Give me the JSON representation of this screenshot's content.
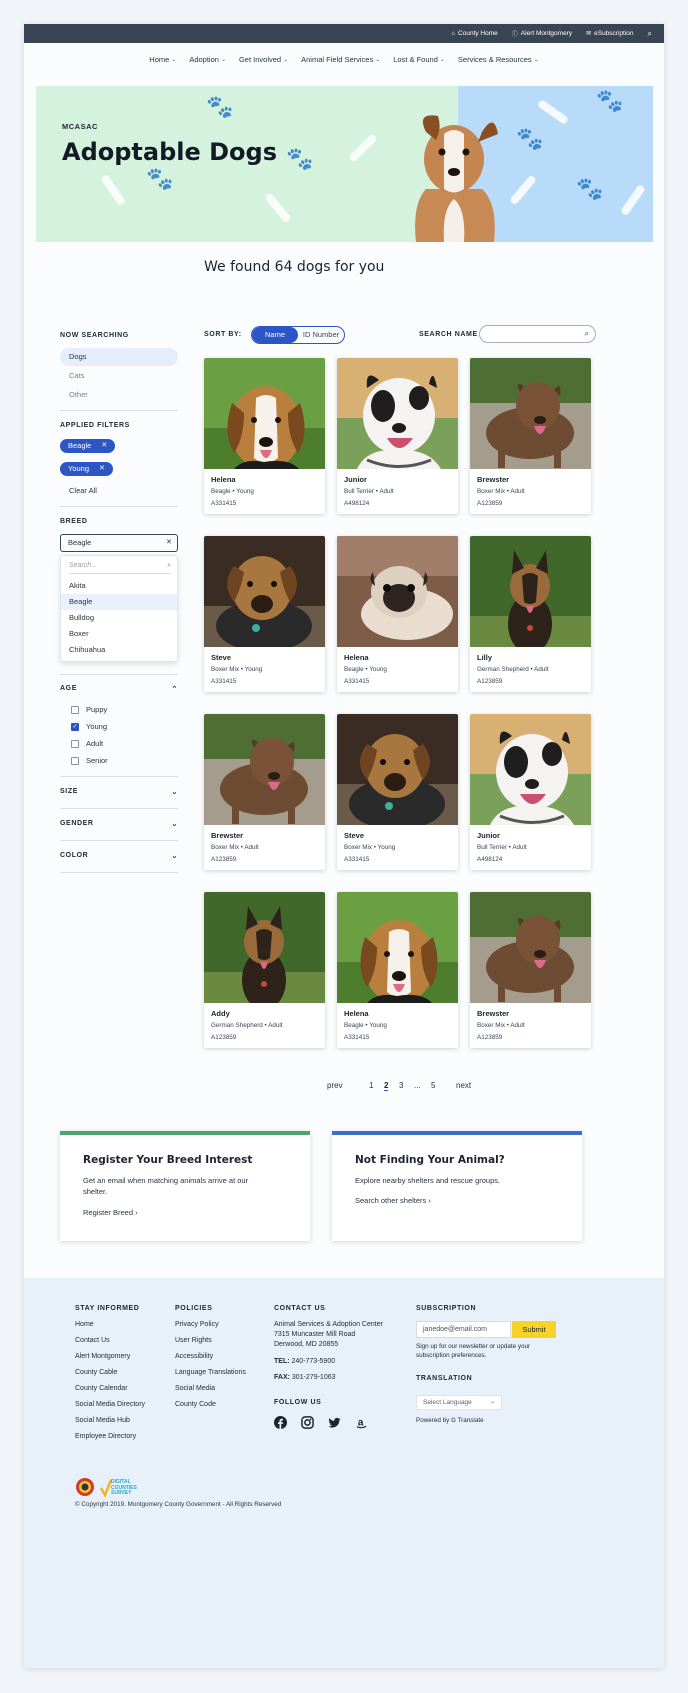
{
  "utility_bar": {
    "links": [
      "County Home",
      "Alert Montgomery",
      "eSubscription"
    ]
  },
  "main_nav": {
    "items": [
      "Home",
      "Adoption",
      "Get Involved",
      "Animal Field Services",
      "Lost & Found",
      "Services & Resources"
    ]
  },
  "hero": {
    "eyebrow": "MCASAC",
    "title": "Adoptable Dogs"
  },
  "results": {
    "title": "We found 64 dogs for you"
  },
  "sidebar": {
    "now_searching_label": "NOW SEARCHING",
    "species": [
      "Dogs",
      "Cats",
      "Other"
    ],
    "applied_filters_label": "APPLIED FILTERS",
    "chips": [
      "Beagle",
      "Young"
    ],
    "clear_all": "Clear All",
    "breed_label": "BREED",
    "breed_value": "Beagle",
    "breed_search_placeholder": "Search...",
    "breed_options": [
      "Akita",
      "Beagle",
      "Bulldog",
      "Boxer",
      "Chihuahua"
    ],
    "age_label": "AGE",
    "age_options": [
      {
        "label": "Puppy",
        "checked": false
      },
      {
        "label": "Young",
        "checked": true
      },
      {
        "label": "Adult",
        "checked": false
      },
      {
        "label": "Senior",
        "checked": false
      }
    ],
    "size_label": "SIZE",
    "gender_label": "GENDER",
    "color_label": "COLOR"
  },
  "sort": {
    "label": "SORT BY:",
    "options": [
      "Name",
      "ID Number"
    ],
    "selected": "Name",
    "search_label": "SEARCH NAME"
  },
  "cards": [
    {
      "name": "Helena",
      "meta": "Beagle • Young",
      "id": "A331415",
      "breed_kind": "beagle"
    },
    {
      "name": "Junior",
      "meta": "Bull Terrier • Adult",
      "id": "A498124",
      "breed_kind": "bullterrier"
    },
    {
      "name": "Brewster",
      "meta": "Boxer Mix • Adult",
      "id": "A123859",
      "breed_kind": "brewster"
    },
    {
      "name": "Steve",
      "meta": "Boxer Mix • Young",
      "id": "A331415",
      "breed_kind": "steve"
    },
    {
      "name": "Helena",
      "meta": "Beagle • Young",
      "id": "A331415",
      "breed_kind": "pug"
    },
    {
      "name": "Lilly",
      "meta": "German Shepherd • Adult",
      "id": "A123859",
      "breed_kind": "shepherd"
    },
    {
      "name": "Brewster",
      "meta": "Boxer Mix • Adult",
      "id": "A123859",
      "breed_kind": "brewster"
    },
    {
      "name": "Steve",
      "meta": "Boxer Mix • Young",
      "id": "A331415",
      "breed_kind": "steve"
    },
    {
      "name": "Junior",
      "meta": "Bull Terrier • Adult",
      "id": "A498124",
      "breed_kind": "bullterrier"
    },
    {
      "name": "Addy",
      "meta": "German Shepherd • Adult",
      "id": "A123859",
      "breed_kind": "shepherd"
    },
    {
      "name": "Helena",
      "meta": "Beagle • Young",
      "id": "A331415",
      "breed_kind": "beagle"
    },
    {
      "name": "Brewster",
      "meta": "Boxer Mix • Adult",
      "id": "A123859",
      "breed_kind": "brewster"
    }
  ],
  "pagination": {
    "prev": "prev",
    "pages": [
      "1",
      "2",
      "3",
      "...",
      "5"
    ],
    "current": "2",
    "next": "next"
  },
  "cta": {
    "breed": {
      "title": "Register Your Breed Interest",
      "text": "Get an email when matching animals arrive at our shelter.",
      "link": "Register Breed",
      "accent": "#4aa66a"
    },
    "notfound": {
      "title": "Not Finding Your Animal?",
      "text": "Explore nearby shelters and rescue groups.",
      "link": "Search other shelters",
      "accent": "#3c6fc9"
    }
  },
  "footer": {
    "stay_informed": {
      "heading": "STAY INFORMED",
      "links": [
        "Home",
        "Contact Us",
        "Alert Montgomery",
        "County Cable",
        "County Calendar",
        "Social Media Directory",
        "Social Media Hub",
        "Employee Directory"
      ]
    },
    "policies": {
      "heading": "POLICIES",
      "links": [
        "Privacy Policy",
        "User Rights",
        "Accessibility",
        "Language Translations",
        "Social Media",
        "County Code"
      ]
    },
    "contact": {
      "heading": "CONTACT US",
      "address_lines": [
        "Animal Services & Adoption Center",
        "7315 Muncaster Mill Road",
        "Derwood, MD 20855"
      ],
      "tel_label": "TEL:",
      "tel": "240-773-5900",
      "fax_label": "FAX:",
      "fax": "301-279-1063",
      "follow_heading": "FOLLOW US",
      "social_icons": [
        "facebook-icon",
        "instagram-icon",
        "twitter-icon",
        "amazon-icon"
      ]
    },
    "subscription": {
      "heading": "SUBSCRIPTION",
      "email_placeholder": "janedoe@email.com",
      "submit": "Submit",
      "note": "Sign up for our newsletter or update your subscription preferences.",
      "translation_heading": "TRANSLATION",
      "select_language": "Select Language",
      "powered_by": "Powered by",
      "translate": "Translate"
    },
    "logo_text": "DIGITAL COUNTIES SURVEY",
    "copyright": "© Copyright 2019. Montgomery County Government - All Rights Reserved"
  },
  "colors": {
    "accent_blue": "#2c55c5",
    "hero_green": "#d4f2de",
    "hero_blue": "#b9dbfa",
    "utility_bar": "#3a4553",
    "submit_yellow": "#f7d327"
  }
}
